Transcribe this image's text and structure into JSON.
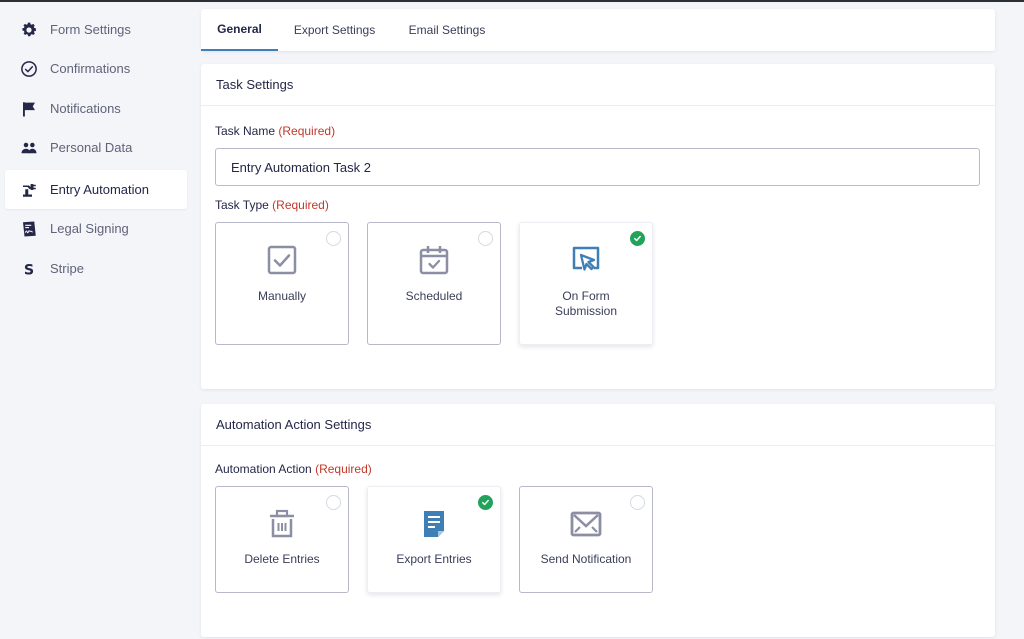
{
  "sidebar": {
    "items": [
      {
        "label": "Form Settings",
        "icon": "gear-icon",
        "active": false
      },
      {
        "label": "Confirmations",
        "icon": "check-circle-icon",
        "active": false
      },
      {
        "label": "Notifications",
        "icon": "flag-icon",
        "active": false
      },
      {
        "label": "Personal Data",
        "icon": "users-icon",
        "active": false
      },
      {
        "label": "Entry Automation",
        "icon": "robot-arm-icon",
        "active": true
      },
      {
        "label": "Legal Signing",
        "icon": "signature-icon",
        "active": false
      },
      {
        "label": "Stripe",
        "icon": "stripe-icon",
        "active": false
      }
    ]
  },
  "tabs": [
    {
      "label": "General",
      "active": true
    },
    {
      "label": "Export Settings",
      "active": false
    },
    {
      "label": "Email Settings",
      "active": false
    }
  ],
  "task_settings": {
    "title": "Task Settings",
    "task_name_label": "Task Name",
    "required_text": "(Required)",
    "task_name_value": "Entry Automation Task 2",
    "task_type_label": "Task Type",
    "task_types": [
      {
        "label": "Manually",
        "icon": "checkbox-icon",
        "selected": false
      },
      {
        "label": "Scheduled",
        "icon": "calendar-check-icon",
        "selected": false
      },
      {
        "label": "On Form Submission",
        "icon": "cursor-click-icon",
        "selected": true
      }
    ]
  },
  "action_settings": {
    "title": "Automation Action Settings",
    "action_label": "Automation Action",
    "required_text": "(Required)",
    "actions": [
      {
        "label": "Delete Entries",
        "icon": "trash-icon",
        "selected": false
      },
      {
        "label": "Export Entries",
        "icon": "document-icon",
        "selected": true
      },
      {
        "label": "Send Notification",
        "icon": "envelope-icon",
        "selected": false
      }
    ]
  },
  "colors": {
    "accent": "#3e7fb5",
    "selected_check": "#21a35a",
    "required": "#c0392b",
    "icon_gray": "#8c8fa3"
  }
}
